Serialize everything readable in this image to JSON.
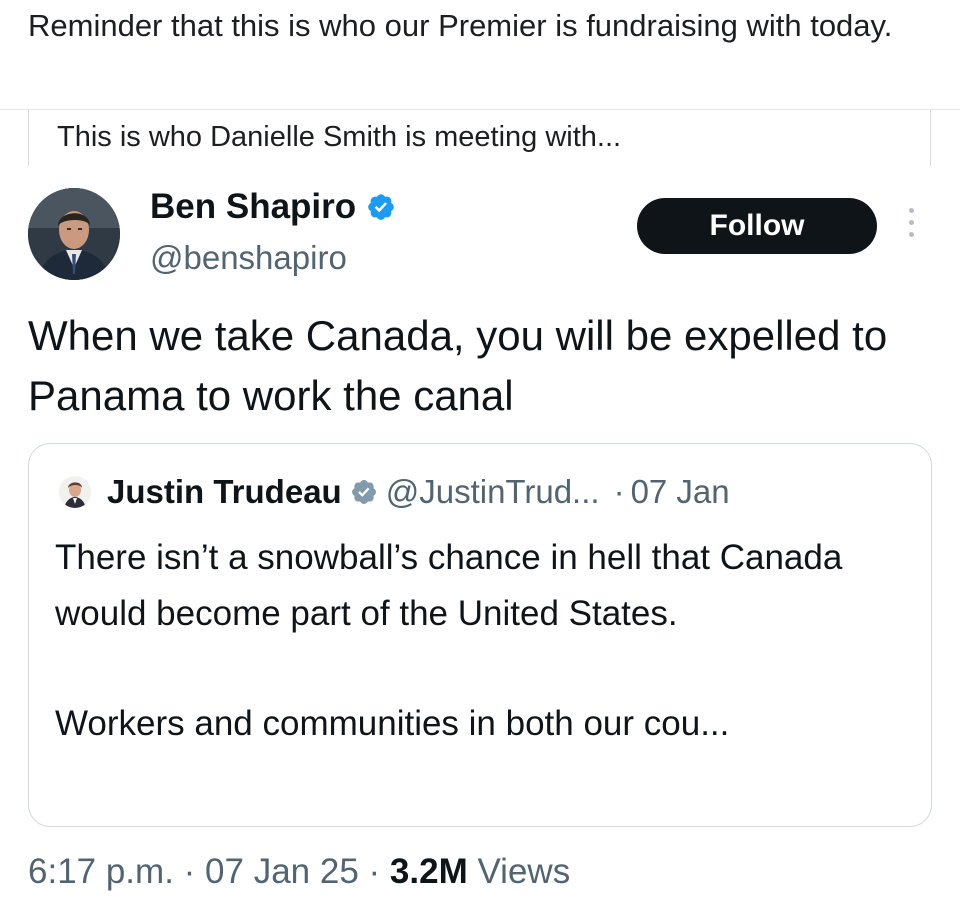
{
  "post": {
    "caption": "Reminder that this is who our Premier is fundraising with today.",
    "share_text": "This is who Danielle Smith is meeting with..."
  },
  "tweet": {
    "display_name": "Ben Shapiro",
    "handle": "@benshapiro",
    "follow_label": "Follow",
    "text": "When we take Canada, you will be expelled to Panama to work the canal",
    "timestamp": "6:17 p.m.",
    "separator": "·",
    "date": "07 Jan 25",
    "views_count": "3.2M",
    "views_label": "Views"
  },
  "quote": {
    "display_name": "Justin Trudeau",
    "handle": "@JustinTrud...",
    "separator": "·",
    "date": "07 Jan",
    "paragraph1": "There isn’t a snowball’s chance in hell that Canada would become part of the United States.",
    "paragraph2": "Workers and communities in both our cou..."
  },
  "colors": {
    "verified_blue": "#1d9bf0",
    "verified_gray": "#829aab",
    "follow_bg": "#0f1419",
    "secondary_text": "#536471"
  },
  "icons": [
    "verified-badge-icon",
    "government-verified-badge-icon",
    "more-options-icon"
  ]
}
